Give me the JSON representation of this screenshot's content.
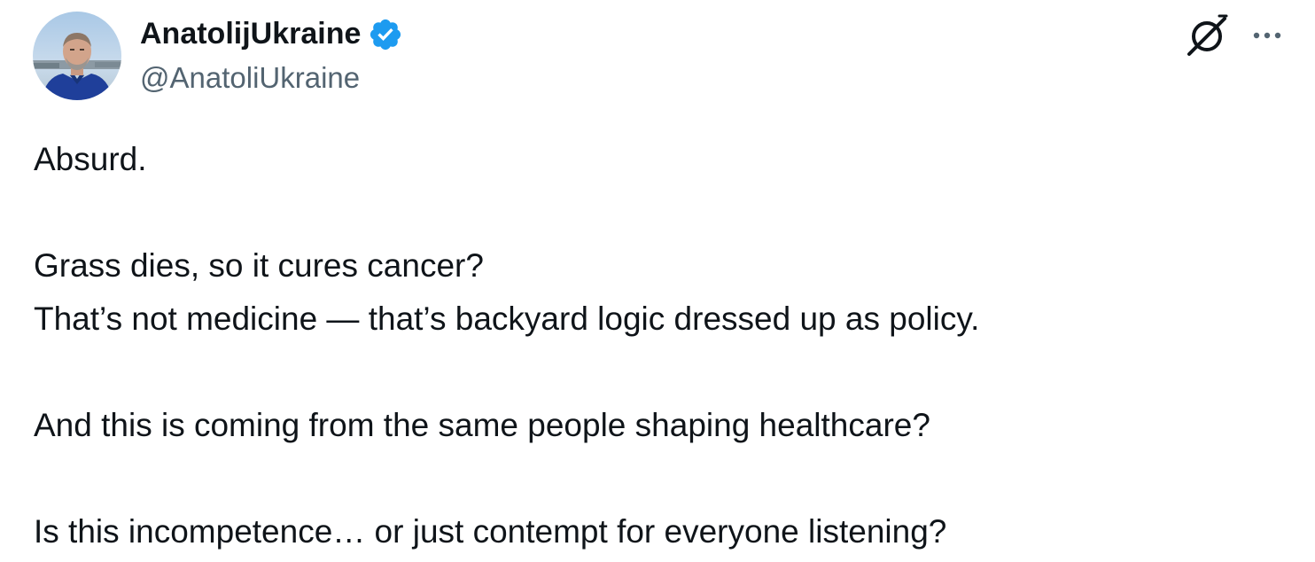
{
  "author": {
    "display_name": "AnatolijUkraine",
    "handle": "@AnatoliUkraine",
    "verified": true,
    "verified_color": "#1d9bf0"
  },
  "actions": {
    "grok_icon": "grok-icon",
    "more_icon": "more-icon"
  },
  "tweet": {
    "line1": "Absurd.",
    "line2": "Grass dies, so it cures cancer?",
    "line3": "That’s not medicine — that’s backyard logic dressed up as policy.",
    "line4": "And this is coming from the same people shaping healthcare?",
    "line5": "Is this incompetence… or just contempt for everyone listening?"
  },
  "colors": {
    "text_primary": "#0f1419",
    "text_secondary": "#536471"
  }
}
